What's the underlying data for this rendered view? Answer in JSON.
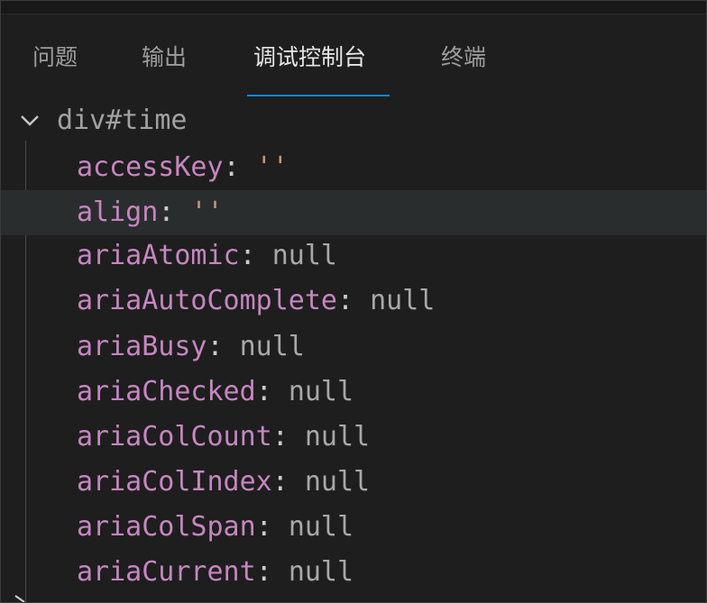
{
  "panel": {
    "tabs": [
      {
        "label": "问题",
        "active": false
      },
      {
        "label": "输出",
        "active": false
      },
      {
        "label": "调试控制台",
        "active": true
      },
      {
        "label": "终端",
        "active": false
      }
    ],
    "accent_color": "#0e8ad8"
  },
  "tree": {
    "root_icon": "chevron-down-icon",
    "root_label": "div#time",
    "properties": [
      {
        "name": "accessKey",
        "colon": ":",
        "value": "''",
        "kind": "string"
      },
      {
        "name": "align",
        "colon": ":",
        "value": "''",
        "kind": "string"
      },
      {
        "name": "ariaAtomic",
        "colon": ":",
        "value": "null",
        "kind": "null"
      },
      {
        "name": "ariaAutoComplete",
        "colon": ":",
        "value": "null",
        "kind": "null"
      },
      {
        "name": "ariaBusy",
        "colon": ":",
        "value": "null",
        "kind": "null"
      },
      {
        "name": "ariaChecked",
        "colon": ":",
        "value": "null",
        "kind": "null"
      },
      {
        "name": "ariaColCount",
        "colon": ":",
        "value": "null",
        "kind": "null"
      },
      {
        "name": "ariaColIndex",
        "colon": ":",
        "value": "null",
        "kind": "null"
      },
      {
        "name": "ariaColSpan",
        "colon": ":",
        "value": "null",
        "kind": "null"
      },
      {
        "name": "ariaCurrent",
        "colon": ":",
        "value": "null",
        "kind": "null"
      }
    ],
    "colors": {
      "property_name": "#c586c0",
      "null_value": "#a8a8a8",
      "string_value": "#ce9178",
      "hover_row": "#2a2d2e"
    }
  }
}
